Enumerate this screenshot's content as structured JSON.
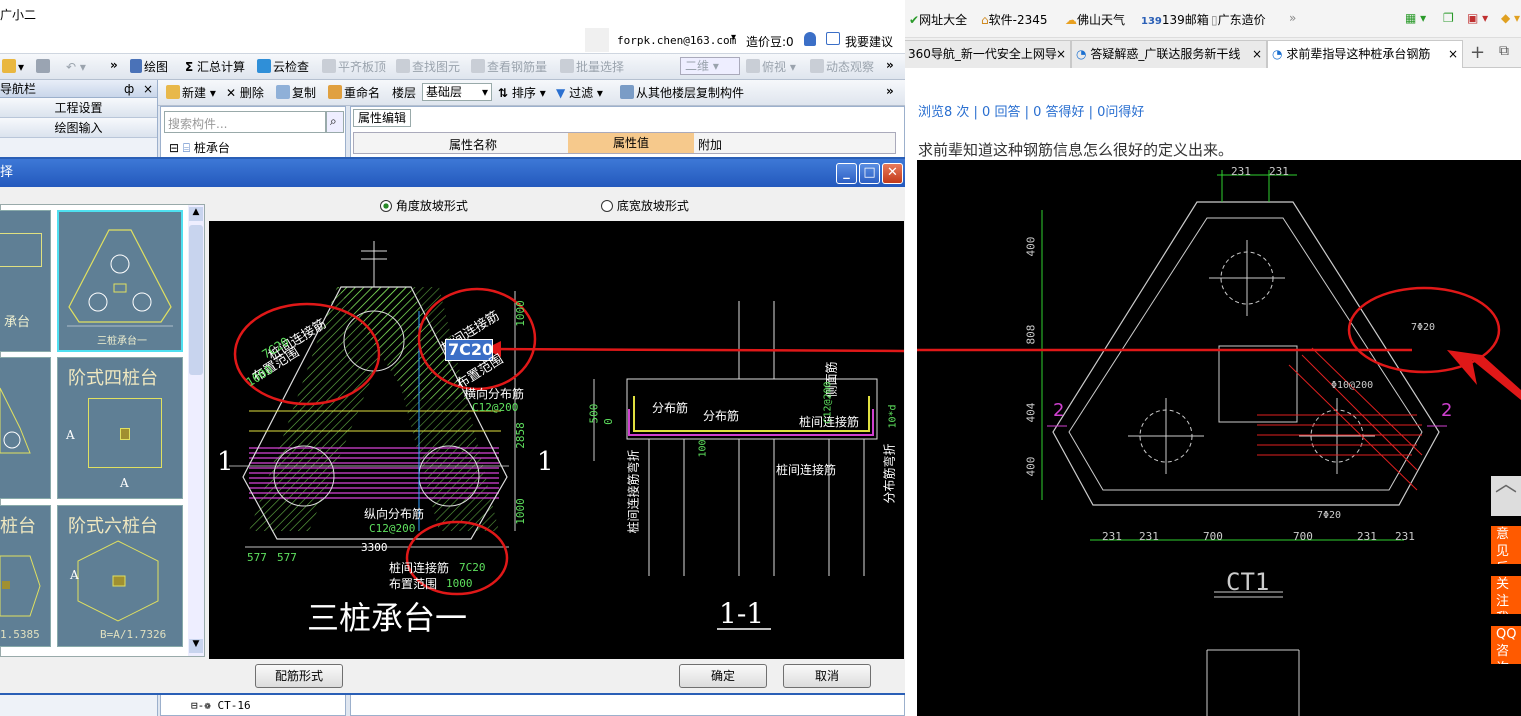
{
  "app": {
    "title_fragment": "广小二",
    "user_email": "forpk.chen@163.com",
    "cost_beans": "造价豆:0",
    "suggest": "我要建议"
  },
  "toolbar1": {
    "draw": "绘图",
    "sum": "汇总计算",
    "cloud_check": "云检查",
    "flat_top": "平齐板顶",
    "find_elem": "查找图元",
    "view_rebar": "查看钢筋量",
    "batch_select": "批量选择",
    "view_2d": "二维",
    "view_top": "俯视",
    "dynamic": "动态观察"
  },
  "toolbar2": {
    "new": "新建",
    "delete": "删除",
    "copy": "复制",
    "rename": "重命名",
    "floor_label": "楼层",
    "floor_value": "基础层",
    "sort": "排序",
    "filter": "过滤",
    "copy_from_floor": "从其他楼层复制构件"
  },
  "nav": {
    "title": "导航栏",
    "pin": "ф",
    "close": "×",
    "project_settings": "工程设置",
    "draw_input": "绘图输入"
  },
  "component": {
    "search_placeholder": "搜索构件...",
    "tree_root": "桩承台",
    "tree_leaf": "CT-16"
  },
  "props": {
    "tab": "属性编辑",
    "col_name": "属性名称",
    "col_value": "属性值",
    "col_extra": "附加"
  },
  "dialog": {
    "title_fragment": "择",
    "radio_angle": "角度放坡形式",
    "radio_width": "底宽放坡形式",
    "thumb_three_pile": "三桩承台一",
    "thumb_step_four": "阶式四桩台",
    "thumb_step_six": "阶式六桩台",
    "thumb_pile_table": "桩台",
    "thumb_partial_label": "承台",
    "thumb_formula_1": "1.5385",
    "thumb_formula_2": "B=A/1.7326",
    "thumb_dim_a": "A",
    "btn_rebar_form": "配筋形式",
    "btn_ok": "确定",
    "btn_cancel": "取消"
  },
  "cad_left": {
    "title": "三桩承台一",
    "section_title": "1-1",
    "section_mark": "1",
    "label_link_rebar_1": "桩间连接筋",
    "label_7c20_green": "7C20",
    "label_range_1": "布置范围",
    "label_1000": "1000",
    "label_link_rebar_2": "桩间连接筋",
    "input_value": "7C20",
    "label_range_2": "布置范围",
    "label_cross_dist": "横向分布筋",
    "label_c12_200_a": "C12@200",
    "label_long_dist": "纵向分布筋",
    "label_c12_200_b": "C12@200",
    "label_link_rebar_3": "桩间连接筋",
    "label_range_3": "布置范围",
    "label_7c20_b": "7C20",
    "label_1000_b": "1000",
    "dim_3300": "3300",
    "dim_577a": "577",
    "dim_577b": "577",
    "dim_1000a": "1000",
    "dim_2858": "2858",
    "dim_1000b": "1000",
    "sec_dist1": "分布筋",
    "sec_dist2": "分布筋",
    "sec_side": "侧面筋",
    "sec_link": "桩间连接筋",
    "sec_link2": "桩间连接筋",
    "sec_link_bend": "桩间连接筋弯折",
    "sec_dist_bend": "分布筋弯折",
    "sec_500": "500",
    "sec_0": "0",
    "sec_100": "100",
    "sec_10d": "10*d",
    "sec_c12": "C12@200"
  },
  "browser": {
    "bookmarks": [
      "网址大全",
      "软件-2345",
      "佛山天气",
      "139邮箱",
      "广东造价"
    ],
    "more": "»",
    "tabs": [
      "360导航_新一代安全上网导",
      "答疑解惑_广联达服务新干线",
      "求前辈指导这种桩承台钢筋"
    ],
    "new_tab": "+",
    "stats": "浏览8 次 | 0 回答 | 0 答得好 | 0问得好",
    "question": "求前辈知道这种钢筋信息怎么很好的定义出来。",
    "side_feedback": "意见反馈",
    "side_follow": "关注我们",
    "side_qq": "QQ咨询",
    "side_top": "︿"
  },
  "cad_right": {
    "dim_231a": "231",
    "dim_231b": "231",
    "dim_400a": "400",
    "dim_808": "808",
    "dim_404": "404",
    "dim_400b": "400",
    "label_7d20_top": "7Φ20",
    "label_d10": "Φ10@200",
    "label_7d20_bottom": "7Φ20",
    "bottom_dims": [
      "231",
      "231",
      "700",
      "700",
      "231",
      "231"
    ],
    "section_mark": "2",
    "title": "CT1"
  }
}
